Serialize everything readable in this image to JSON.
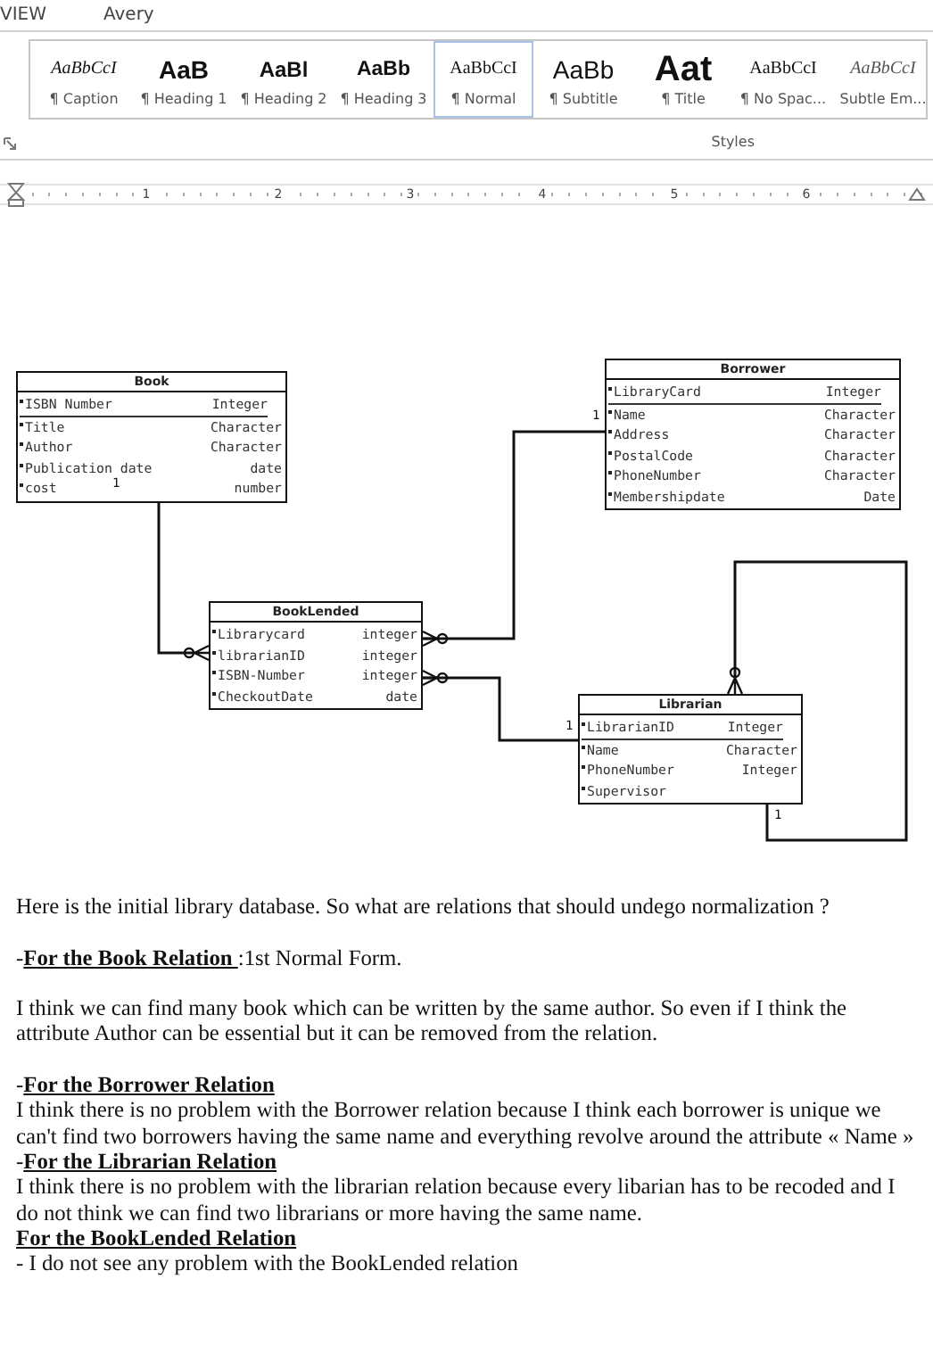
{
  "ribbon": {
    "tabs": [
      {
        "label": "VIEW",
        "selected": false
      },
      {
        "label": "Avery",
        "selected": false
      }
    ],
    "styles": [
      {
        "kind": "caption",
        "sample": "AaBbCcI",
        "label": "¶ Caption",
        "selected": false
      },
      {
        "kind": "heading1",
        "sample": "AaB",
        "label": "¶ Heading 1",
        "selected": false
      },
      {
        "kind": "heading2",
        "sample": "AaBl",
        "label": "¶ Heading 2",
        "selected": false
      },
      {
        "kind": "heading3",
        "sample": "AaBb",
        "label": "¶ Heading 3",
        "selected": false
      },
      {
        "kind": "normal",
        "sample": "AaBbCcI",
        "label": "¶ Normal",
        "selected": true
      },
      {
        "kind": "subtitle",
        "sample": "AaBb",
        "label": "¶ Subtitle",
        "selected": false
      },
      {
        "kind": "title",
        "sample": "Aat",
        "label": "¶ Title",
        "selected": false
      },
      {
        "kind": "nospacing",
        "sample": "AaBbCcI",
        "label": "¶ No Spac...",
        "selected": false
      },
      {
        "kind": "subtle",
        "sample": "AaBbCcI",
        "label": "Subtle Em...",
        "selected": false
      }
    ],
    "group_label": "Styles"
  },
  "ruler": {
    "numbers": [
      "1",
      "2",
      "3",
      "4",
      "5",
      "6"
    ]
  },
  "diagram": {
    "entities": [
      {
        "name": "Book",
        "attributes": [
          {
            "name": "ISBN Number",
            "type": "Integer",
            "key": true
          },
          {
            "name": "Title",
            "type": "Character",
            "key": false
          },
          {
            "name": "Author",
            "type": "Character",
            "key": false
          },
          {
            "name": "Publication date",
            "type": "date",
            "key": false
          },
          {
            "name": "cost",
            "type": "number",
            "key": false
          }
        ]
      },
      {
        "name": "BookLended",
        "attributes": [
          {
            "name": "Librarycard",
            "type": "integer",
            "key": false
          },
          {
            "name": "librarianID",
            "type": "integer",
            "key": false
          },
          {
            "name": "ISBN-Number",
            "type": "integer",
            "key": false
          },
          {
            "name": "CheckoutDate",
            "type": "date",
            "key": false
          }
        ]
      },
      {
        "name": "Borrower",
        "attributes": [
          {
            "name": "LibraryCard",
            "type": "Integer",
            "key": true
          },
          {
            "name": "Name",
            "type": "Character",
            "key": false
          },
          {
            "name": "Address",
            "type": "Character",
            "key": false
          },
          {
            "name": "PostalCode",
            "type": "Character",
            "key": false
          },
          {
            "name": "PhoneNumber",
            "type": "Character",
            "key": false
          },
          {
            "name": "Membershipdate",
            "type": "Date",
            "key": false
          }
        ]
      },
      {
        "name": "Librarian",
        "attributes": [
          {
            "name": "LibrarianID",
            "type": "Integer",
            "key": true
          },
          {
            "name": "Name",
            "type": "Character",
            "key": false
          },
          {
            "name": "PhoneNumber",
            "type": "Integer",
            "key": false
          },
          {
            "name": "Supervisor",
            "key": false
          }
        ]
      }
    ],
    "connectors": [
      {
        "label": "1"
      },
      {
        "label": "1"
      },
      {
        "label": "1"
      },
      {
        "label": "1"
      }
    ]
  },
  "document": [
    [
      {
        "kind": "paragraph",
        "text": "Here is the initial  library database. So what are relations that should undego normalization ?"
      }
    ],
    [
      {
        "kind": "heading",
        "lead": "-",
        "title": "For the Book Relation ",
        "after": ":1st Normal Form."
      }
    ],
    [
      {
        "kind": "paragraph",
        "text": "I think we can find many book which can be written by the same author. So even if I think the attribute Author can be essential but it can be removed from the relation."
      }
    ],
    [
      {
        "kind": "heading",
        "lead": "-",
        "title": "For the Borrower Relation "
      },
      {
        "kind": "paragraph",
        "text": "I think there is no problem with the Borrower relation because I think each borrower is unique we can't find two borrowers having the same name and everything revolve around the attribute « Name »"
      },
      {
        "kind": "heading",
        "lead": "-",
        "title": "For the Librarian  Relation "
      },
      {
        "kind": "paragraph",
        "text": "I think there is no problem with the librarian relation because every libarian has to be recoded and I do not think we can find two librarians or more having the same name."
      },
      {
        "kind": "heading",
        "title": "For the BookLended  Relation "
      },
      {
        "kind": "paragraph",
        "text": "- I do not see any problem with the BookLended relation"
      }
    ]
  ]
}
